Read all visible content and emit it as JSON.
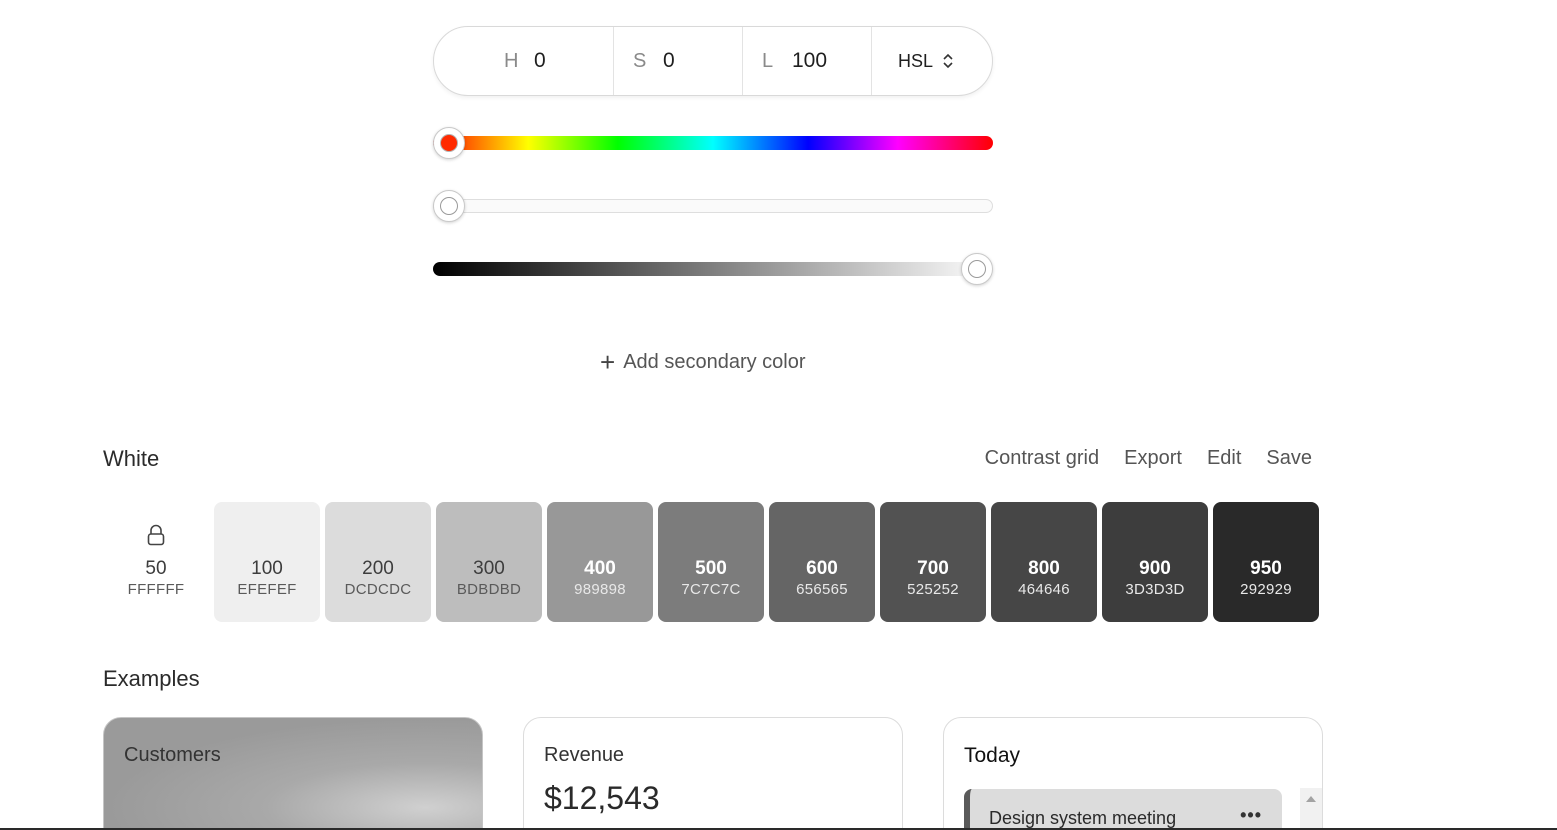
{
  "color_input": {
    "h_label": "H",
    "h_value": "0",
    "s_label": "S",
    "s_value": "0",
    "l_label": "L",
    "l_value": "100",
    "mode": "HSL"
  },
  "sliders": {
    "hue": 0,
    "saturation": 0,
    "lightness": 100
  },
  "add_secondary": {
    "label": "Add secondary color",
    "icon": "plus-icon"
  },
  "palette": {
    "name": "White",
    "actions": [
      "Contrast grid",
      "Export",
      "Edit",
      "Save"
    ],
    "swatches": [
      {
        "shade": "50",
        "hex": "FFFFFF",
        "color": "#FFFFFF",
        "locked": true
      },
      {
        "shade": "100",
        "hex": "EFEFEF",
        "color": "#EFEFEF"
      },
      {
        "shade": "200",
        "hex": "DCDCDC",
        "color": "#DCDCDC"
      },
      {
        "shade": "300",
        "hex": "BDBDBD",
        "color": "#BDBDBD"
      },
      {
        "shade": "400",
        "hex": "989898",
        "color": "#989898"
      },
      {
        "shade": "500",
        "hex": "7C7C7C",
        "color": "#7C7C7C"
      },
      {
        "shade": "600",
        "hex": "656565",
        "color": "#656565"
      },
      {
        "shade": "700",
        "hex": "525252",
        "color": "#525252"
      },
      {
        "shade": "800",
        "hex": "464646",
        "color": "#464646"
      },
      {
        "shade": "900",
        "hex": "3D3D3D",
        "color": "#3D3D3D"
      },
      {
        "shade": "950",
        "hex": "292929",
        "color": "#292929"
      }
    ]
  },
  "examples": {
    "title": "Examples",
    "customers": {
      "title": "Customers"
    },
    "revenue": {
      "title": "Revenue",
      "value": "$12,543"
    },
    "today": {
      "title": "Today",
      "event": "Design system meeting",
      "more": "•••"
    }
  }
}
